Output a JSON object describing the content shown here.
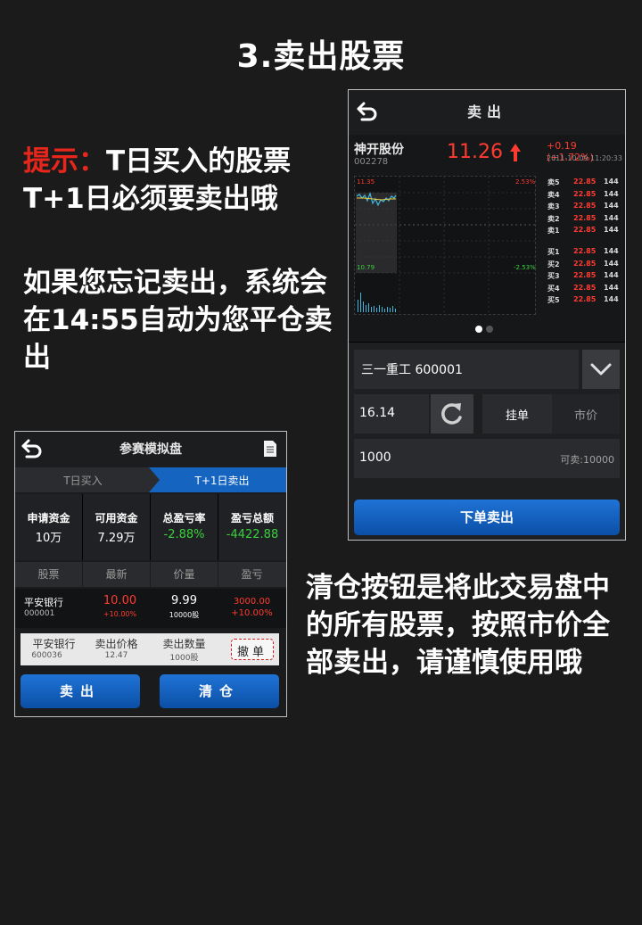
{
  "page": {
    "title": "3.卖出股票",
    "tip_label": "提示：",
    "tip_line1": "T日买入的股票",
    "tip_line2": "T+1日必须要卖出哦",
    "forget_note": "如果您忘记卖出，系统会在14:55自动为您平仓卖出",
    "clear_note": "清仓按钮是将此交易盘中的所有股票，按照市价全部卖出，请谨慎使用哦"
  },
  "sell_screen": {
    "title": "卖出",
    "stock": {
      "name": "神开股份",
      "code": "002278",
      "price": "11.26",
      "change": "+0.19 (+1.72%)",
      "datetime": "2011-10-09   11:20:33"
    },
    "chart": {
      "high_label": "11.35",
      "high_pct": "2.53%",
      "low_label": "10.79",
      "low_pct": "-2.53%"
    },
    "order_book": {
      "asks": [
        {
          "label": "卖5",
          "price": "22.85",
          "volume": "144"
        },
        {
          "label": "卖4",
          "price": "22.85",
          "volume": "144"
        },
        {
          "label": "卖3",
          "price": "22.85",
          "volume": "144"
        },
        {
          "label": "卖2",
          "price": "22.85",
          "volume": "144"
        },
        {
          "label": "卖1",
          "price": "22.85",
          "volume": "144"
        }
      ],
      "bids": [
        {
          "label": "买1",
          "price": "22.85",
          "volume": "144"
        },
        {
          "label": "买2",
          "price": "22.85",
          "volume": "144"
        },
        {
          "label": "买3",
          "price": "22.85",
          "volume": "144"
        },
        {
          "label": "买4",
          "price": "22.85",
          "volume": "144"
        },
        {
          "label": "买5",
          "price": "22.85",
          "volume": "144"
        }
      ]
    },
    "form": {
      "stock_value": "三一重工  600001",
      "price_value": "16.14",
      "limit_order_label": "挂单",
      "market_price_label": "市价",
      "quantity_value": "1000",
      "available_label": "可卖:10000",
      "submit_label": "下单卖出"
    },
    "colors": {
      "up": "#ff3b30",
      "down": "#39d13c",
      "accent": "#1565c0"
    }
  },
  "sim_screen": {
    "title": "参赛模拟盘",
    "tabs": [
      "T日买入",
      "T+1日卖出"
    ],
    "stats": [
      {
        "label": "申请资金",
        "value": "10万",
        "color": "#ffffff"
      },
      {
        "label": "可用资金",
        "value": "7.29万",
        "color": "#ffffff"
      },
      {
        "label": "总盈亏率",
        "value": "-2.88%",
        "color": "#39d13c"
      },
      {
        "label": "盈亏总额",
        "value": "-4422.88",
        "color": "#39d13c"
      }
    ],
    "columns": [
      "股票",
      "最新",
      "价量",
      "盈亏"
    ],
    "row": {
      "name": "平安银行",
      "code": "000001",
      "latest": "10.00",
      "latest_pct": "+10.00%",
      "price": "9.99",
      "volume": "10000股",
      "pnl": "3000.00",
      "pnl_pct": "+10.00%"
    },
    "pending_order": {
      "name": "平安银行",
      "code": "600036",
      "price_label": "卖出价格",
      "price_value": "12.47",
      "qty_label": "卖出数量",
      "qty_value": "1000股",
      "cancel_label": "撤单"
    },
    "sell_button": "卖出",
    "clear_button": "清仓"
  }
}
